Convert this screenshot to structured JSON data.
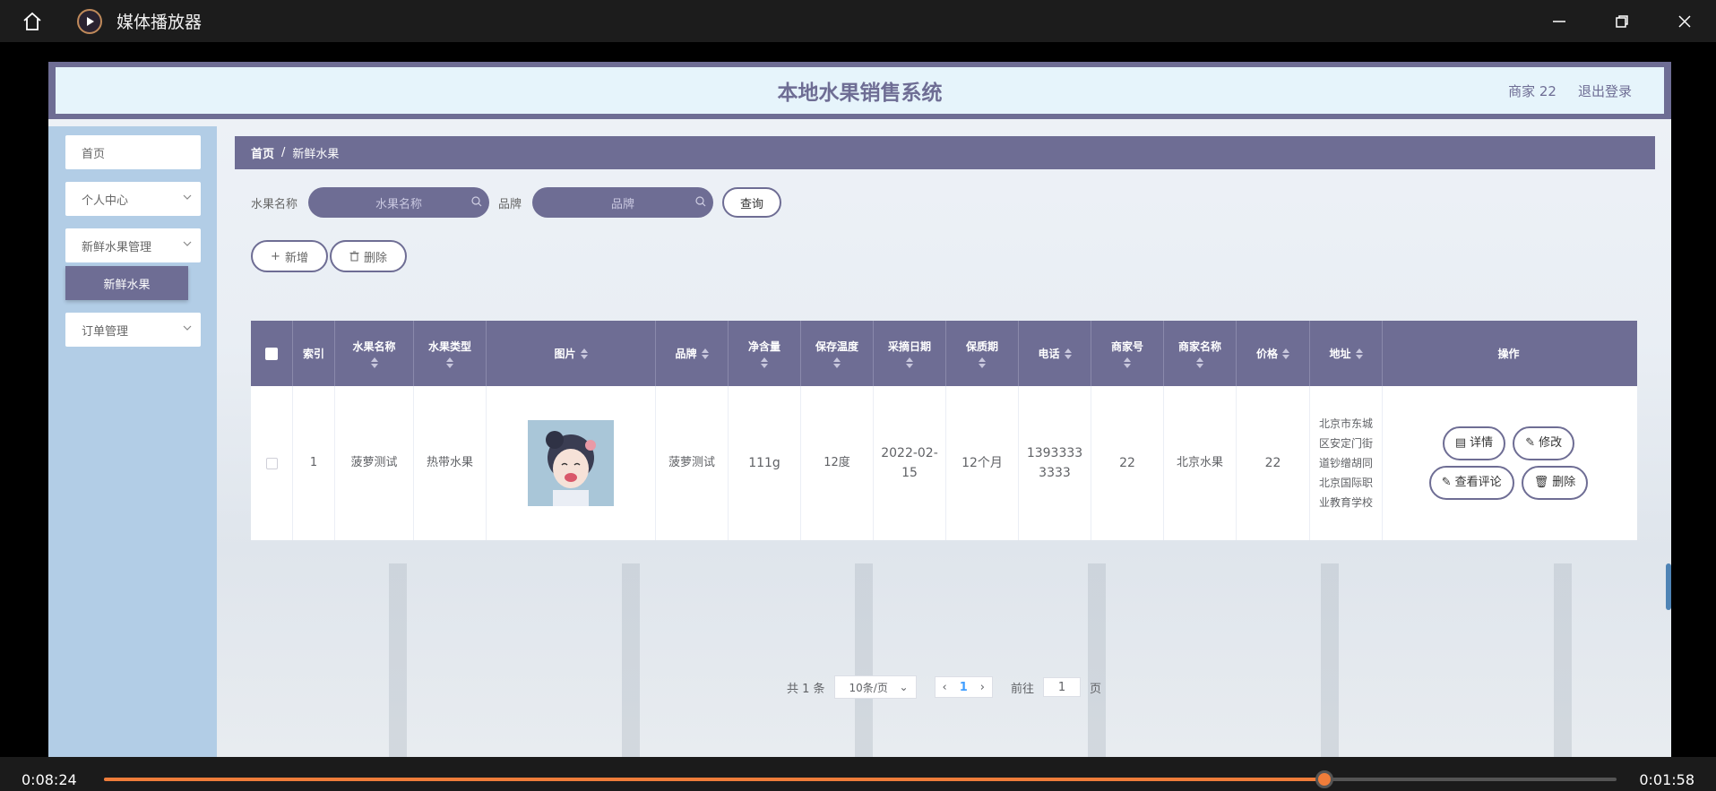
{
  "player": {
    "title": "媒体播放器",
    "time_elapsed": "0:08:24",
    "time_remaining": "0:01:58",
    "progress": 0.807,
    "accent": "#ef7d3a"
  },
  "site": {
    "title": "本地水果销售系统",
    "user": "商家 22",
    "logout": "退出登录",
    "theme_color": "#6e6d94"
  },
  "sidebar": {
    "items": [
      {
        "label": "首页"
      },
      {
        "label": "个人中心"
      },
      {
        "label": "新鲜水果管理"
      },
      {
        "label": "订单管理"
      }
    ],
    "submenu_active": "新鲜水果"
  },
  "breadcrumb": {
    "home": "首页",
    "sep": "/",
    "current": "新鲜水果"
  },
  "search": {
    "name_label": "水果名称",
    "name_placeholder": "水果名称",
    "brand_label": "品牌",
    "brand_placeholder": "品牌",
    "query_button": "查询"
  },
  "actions": {
    "add": "新增",
    "delete": "删除"
  },
  "table": {
    "headers": {
      "index": "索引",
      "name": "水果名称",
      "type": "水果类型",
      "image": "图片",
      "brand": "品牌",
      "net": "净含量",
      "temp": "保存温度",
      "pick_date": "采摘日期",
      "shelf": "保质期",
      "phone": "电话",
      "merchant_no": "商家号",
      "merchant_name": "商家名称",
      "price": "价格",
      "address": "地址",
      "ops": "操作"
    },
    "rows": [
      {
        "index": "1",
        "name": "菠萝测试",
        "type": "热带水果",
        "brand": "菠萝测试",
        "net": "111g",
        "temp": "12度",
        "pick_date": "2022-02-15",
        "shelf": "12个月",
        "phone": "13933333333",
        "merchant_no": "22",
        "merchant_name": "北京水果",
        "price": "22",
        "address": "北京市东城区安定门街道钞缯胡同北京国际职业教育学校"
      }
    ],
    "row_actions": {
      "detail": "详情",
      "edit": "修改",
      "comments": "查看评论",
      "delete": "删除"
    }
  },
  "pager": {
    "total": "共 1 条",
    "page_size": "10条/页",
    "current": "1",
    "goto": "前往",
    "goto_value": "1",
    "page_unit": "页"
  }
}
